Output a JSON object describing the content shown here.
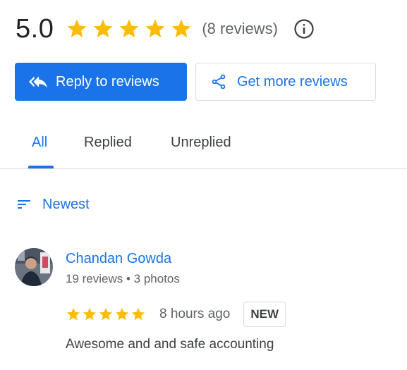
{
  "summary": {
    "rating": "5.0",
    "stars": 5,
    "review_count_label": "(8 reviews)"
  },
  "buttons": {
    "reply_label": "Reply to reviews",
    "get_more_label": "Get more reviews"
  },
  "tabs": {
    "items": [
      {
        "label": "All",
        "active": true
      },
      {
        "label": "Replied",
        "active": false
      },
      {
        "label": "Unreplied",
        "active": false
      }
    ]
  },
  "sort": {
    "label": "Newest"
  },
  "reviews": [
    {
      "name": "Chandan Gowda",
      "meta": "19 reviews • 3 photos",
      "stars": 5,
      "time": "8 hours ago",
      "badge": "NEW",
      "text": "Awesome and and safe accounting"
    }
  ],
  "icons": {
    "star": "star-icon",
    "info": "info-icon",
    "reply": "reply-all-icon",
    "share": "share-icon",
    "sort": "sort-icon"
  },
  "colors": {
    "accent": "#1a73e8",
    "star": "#fbbc04",
    "text": "#3c4043",
    "muted": "#5f6368",
    "border": "#dadce0"
  }
}
